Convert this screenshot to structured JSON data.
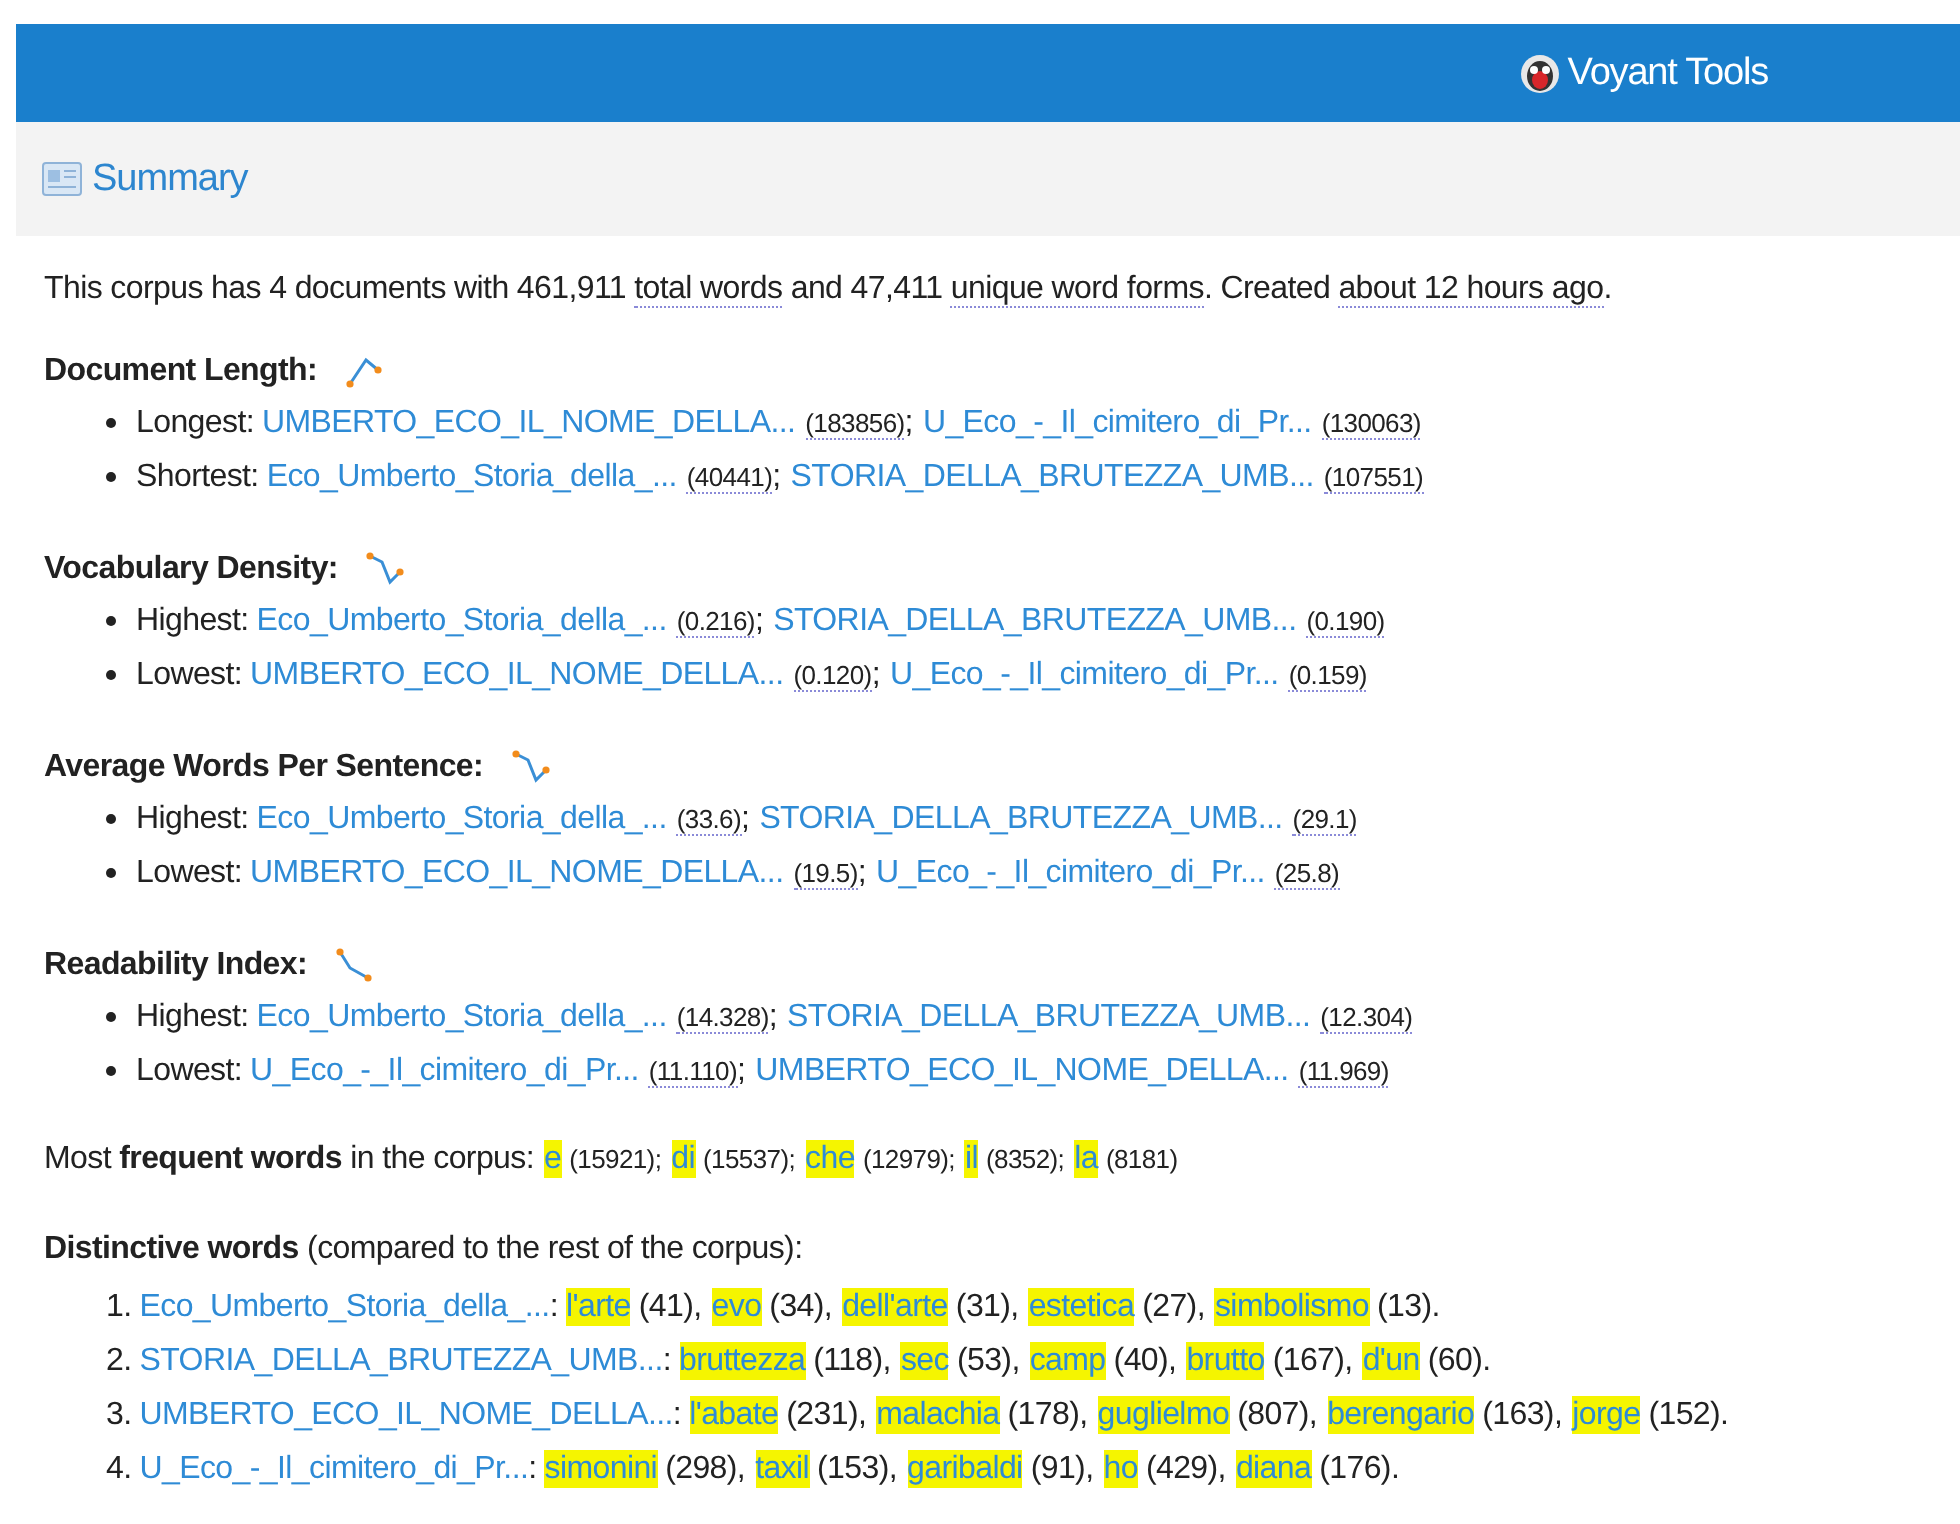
{
  "header": {
    "title": "Voyant Tools"
  },
  "panel": {
    "title": "Summary"
  },
  "summary": [
    {
      "text": "This corpus has 4 documents with 461,911 ",
      "dotted": false
    },
    {
      "text": "total words",
      "dotted": true
    },
    {
      "text": " and 47,411 ",
      "dotted": false
    },
    {
      "text": "unique word forms",
      "dotted": true
    },
    {
      "text": ". Created ",
      "dotted": false
    },
    {
      "text": "about 12 hours ago",
      "dotted": true
    },
    {
      "text": ".",
      "dotted": false
    }
  ],
  "stats": [
    {
      "title": "Document Length:",
      "items": [
        {
          "label": "Longest:",
          "docs": [
            {
              "name": "UMBERTO_ECO_IL_NOME_DELLA...",
              "value": "(183856)",
              "sep": ";"
            },
            {
              "name": "U_Eco_-_Il_cimitero_di_Pr...",
              "value": "(130063)"
            }
          ]
        },
        {
          "label": "Shortest:",
          "docs": [
            {
              "name": "Eco_Umberto_Storia_della_...",
              "value": "(40441)",
              "sep": ";"
            },
            {
              "name": "STORIA_DELLA_BRUTEZZA_UMB...",
              "value": "(107551)"
            }
          ]
        }
      ]
    },
    {
      "title": "Vocabulary Density:",
      "items": [
        {
          "label": "Highest:",
          "docs": [
            {
              "name": "Eco_Umberto_Storia_della_...",
              "value": "(0.216)",
              "sep": ";"
            },
            {
              "name": "STORIA_DELLA_BRUTEZZA_UMB...",
              "value": "(0.190)"
            }
          ]
        },
        {
          "label": "Lowest:",
          "docs": [
            {
              "name": "UMBERTO_ECO_IL_NOME_DELLA...",
              "value": "(0.120)",
              "sep": ";"
            },
            {
              "name": "U_Eco_-_Il_cimitero_di_Pr...",
              "value": "(0.159)"
            }
          ]
        }
      ]
    },
    {
      "title": "Average Words Per Sentence:",
      "items": [
        {
          "label": "Highest:",
          "docs": [
            {
              "name": "Eco_Umberto_Storia_della_...",
              "value": "(33.6)",
              "sep": ";"
            },
            {
              "name": "STORIA_DELLA_BRUTEZZA_UMB...",
              "value": "(29.1)"
            }
          ]
        },
        {
          "label": "Lowest:",
          "docs": [
            {
              "name": "UMBERTO_ECO_IL_NOME_DELLA...",
              "value": "(19.5)",
              "sep": ";"
            },
            {
              "name": "U_Eco_-_Il_cimitero_di_Pr...",
              "value": "(25.8)"
            }
          ]
        }
      ]
    },
    {
      "title": "Readability Index:",
      "items": [
        {
          "label": "Highest:",
          "docs": [
            {
              "name": "Eco_Umberto_Storia_della_...",
              "value": "(14.328)",
              "sep": ";"
            },
            {
              "name": "STORIA_DELLA_BRUTEZZA_UMB...",
              "value": "(12.304)"
            }
          ]
        },
        {
          "label": "Lowest:",
          "docs": [
            {
              "name": "U_Eco_-_Il_cimitero_di_Pr...",
              "value": "(11.110)",
              "sep": ";"
            },
            {
              "name": "UMBERTO_ECO_IL_NOME_DELLA...",
              "value": "(11.969)"
            }
          ]
        }
      ]
    }
  ],
  "frequent": {
    "intro": "Most **frequent words** in the corpus:",
    "words": [
      {
        "word": "e",
        "count": "(15921);"
      },
      {
        "word": "di",
        "count": "(15537);"
      },
      {
        "word": "che",
        "count": "(12979);"
      },
      {
        "word": "il",
        "count": "(8352);"
      },
      {
        "word": "la",
        "count": "(8181)"
      }
    ]
  },
  "distinctive": {
    "intro": "**Distinctive words** (compared to the rest of the corpus):",
    "items": [
      {
        "number": "1.",
        "doc": "Eco_Umberto_Storia_della_...",
        "after": ":",
        "words": [
          {
            "word": "l'arte",
            "count": "(41),"
          },
          {
            "word": "evo",
            "count": "(34),"
          },
          {
            "word": "dell'arte",
            "count": "(31),"
          },
          {
            "word": "estetica",
            "count": "(27),"
          },
          {
            "word": "simbolismo",
            "count": "(13)."
          }
        ]
      },
      {
        "number": "2.",
        "doc": "STORIA_DELLA_BRUTEZZA_UMB...",
        "after": ":",
        "words": [
          {
            "word": "bruttezza",
            "count": "(118),"
          },
          {
            "word": "sec",
            "count": "(53),"
          },
          {
            "word": "camp",
            "count": "(40),"
          },
          {
            "word": "brutto",
            "count": "(167),"
          },
          {
            "word": "d'un",
            "count": "(60)."
          }
        ]
      },
      {
        "number": "3.",
        "doc": "UMBERTO_ECO_IL_NOME_DELLA...",
        "after": ":",
        "words": [
          {
            "word": "l'abate",
            "count": "(231),"
          },
          {
            "word": "malachia",
            "count": "(178),"
          },
          {
            "word": "guglielmo",
            "count": "(807),"
          },
          {
            "word": "berengario",
            "count": "(163),"
          },
          {
            "word": "jorge",
            "count": "(152)."
          }
        ]
      },
      {
        "number": "4.",
        "doc": "U_Eco_-_Il_cimitero_di_Pr...",
        "after": ":",
        "words": [
          {
            "word": "simonini",
            "count": "(298),"
          },
          {
            "word": "taxil",
            "count": "(153),"
          },
          {
            "word": "garibaldi",
            "count": "(91),"
          },
          {
            "word": "ho",
            "count": "(429),"
          },
          {
            "word": "diana",
            "count": "(176)."
          }
        ]
      }
    ]
  }
}
